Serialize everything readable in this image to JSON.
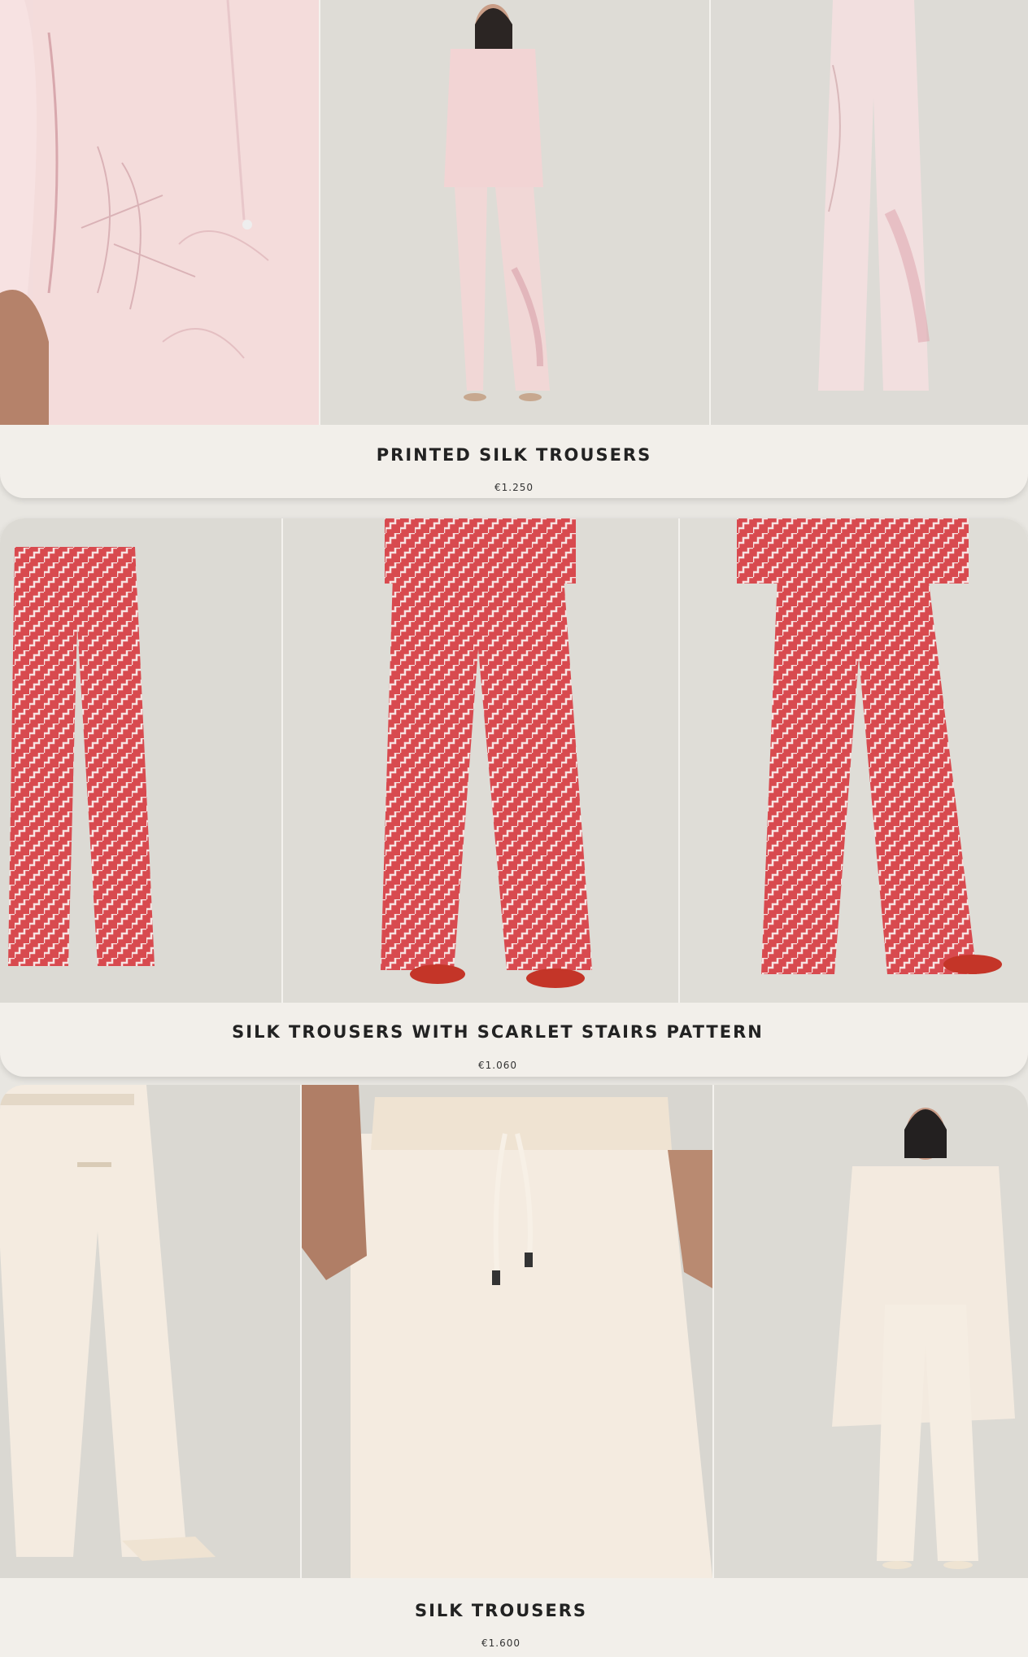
{
  "products": [
    {
      "name": "PRINTED SILK TROUSERS",
      "price": "€1.250",
      "images": [
        "detail-waist-pocket",
        "model-full-suit",
        "flat-trousers"
      ]
    },
    {
      "name": "SILK TROUSERS WITH SCARLET STAIRS PATTERN",
      "price": "€1.060",
      "images": [
        "flat-trousers",
        "model-front",
        "model-back"
      ]
    },
    {
      "name": "SILK TROUSERS",
      "price": "€1.600",
      "images": [
        "model-back",
        "detail-waist-drawstring",
        "model-full-cape"
      ]
    }
  ],
  "colors": {
    "card_bg": "#f2efea",
    "page_bg": "#e8e6e1",
    "blush": "#f1d2d4",
    "scarlet": "#d23a40",
    "ivory": "#f3ebe0",
    "studio": "#dcdad4"
  }
}
